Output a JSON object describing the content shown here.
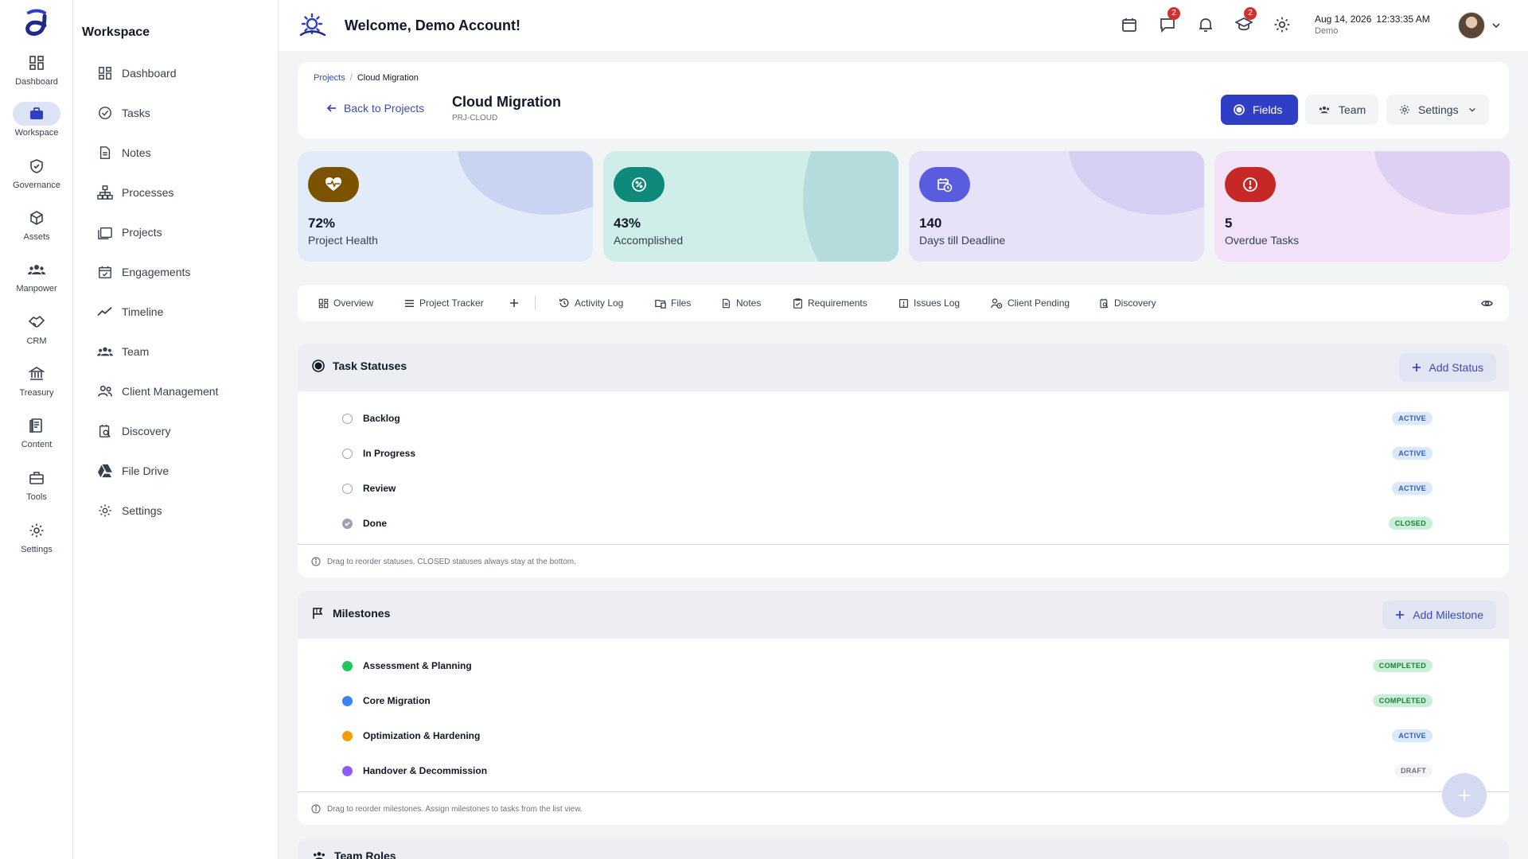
{
  "rail": {
    "items": [
      {
        "label": "Dashboard",
        "icon": "dashboard-icon"
      },
      {
        "label": "Workspace",
        "icon": "briefcase-icon"
      },
      {
        "label": "Governance",
        "icon": "shield-icon"
      },
      {
        "label": "Assets",
        "icon": "cube-icon"
      },
      {
        "label": "Manpower",
        "icon": "people-icon"
      },
      {
        "label": "CRM",
        "icon": "handshake-icon"
      },
      {
        "label": "Treasury",
        "icon": "bank-icon"
      },
      {
        "label": "Content",
        "icon": "document-icon"
      },
      {
        "label": "Tools",
        "icon": "toolbox-icon"
      },
      {
        "label": "Settings",
        "icon": "gear-icon"
      }
    ]
  },
  "sidebar": {
    "title": "Workspace",
    "items": [
      {
        "label": "Dashboard",
        "icon": "dashboard-icon"
      },
      {
        "label": "Tasks",
        "icon": "check-circle-icon"
      },
      {
        "label": "Notes",
        "icon": "note-icon"
      },
      {
        "label": "Processes",
        "icon": "hierarchy-icon"
      },
      {
        "label": "Projects",
        "icon": "folders-icon"
      },
      {
        "label": "Engagements",
        "icon": "calendar-check-icon"
      },
      {
        "label": "Timeline",
        "icon": "trend-icon"
      },
      {
        "label": "Team",
        "icon": "people-icon"
      },
      {
        "label": "Client Management",
        "icon": "clients-icon"
      },
      {
        "label": "Discovery",
        "icon": "search-doc-icon"
      },
      {
        "label": "File Drive",
        "icon": "drive-icon"
      },
      {
        "label": "Settings",
        "icon": "gear-icon"
      }
    ]
  },
  "header": {
    "welcome": "Welcome, Demo Account!",
    "messages_badge": "2",
    "learning_badge": "2",
    "date": "Aug 14, 2026",
    "time": "12:33:35 AM",
    "user": "Demo"
  },
  "project": {
    "breadcrumb_root": "Projects",
    "breadcrumb_sep": "/",
    "breadcrumb_current": "Cloud Migration",
    "back_label": "Back to Projects",
    "name": "Cloud Migration",
    "code": "PRJ-CLOUD",
    "buttons": {
      "fields": "Fields",
      "team": "Team",
      "settings": "Settings"
    }
  },
  "stats": [
    {
      "value": "72%",
      "label": "Project Health",
      "color": "#7a5200"
    },
    {
      "value": "43%",
      "label": "Accomplished",
      "color": "#0f8a7a"
    },
    {
      "value": "140",
      "label": "Days till Deadline",
      "color": "#5a5ce0"
    },
    {
      "value": "5",
      "label": "Overdue Tasks",
      "color": "#c62828"
    }
  ],
  "tabs": [
    "Overview",
    "Project Tracker",
    "Activity Log",
    "Files",
    "Notes",
    "Requirements",
    "Issues Log",
    "Client Pending",
    "Discovery"
  ],
  "statuses": {
    "title": "Task Statuses",
    "add_label": "Add Status",
    "rows": [
      {
        "name": "Backlog",
        "badge": "ACTIVE"
      },
      {
        "name": "In Progress",
        "badge": "ACTIVE"
      },
      {
        "name": "Review",
        "badge": "ACTIVE"
      },
      {
        "name": "Done",
        "badge": "CLOSED"
      }
    ],
    "note": "Drag to reorder statuses. CLOSED statuses always stay at the bottom."
  },
  "milestones": {
    "title": "Milestones",
    "add_label": "Add Milestone",
    "rows": [
      {
        "name": "Assessment & Planning",
        "badge": "COMPLETED",
        "color": "#22c55e"
      },
      {
        "name": "Core Migration",
        "badge": "COMPLETED",
        "color": "#3b82f6"
      },
      {
        "name": "Optimization & Hardening",
        "badge": "ACTIVE",
        "color": "#f59e0b"
      },
      {
        "name": "Handover & Decommission",
        "badge": "DRAFT",
        "color": "#8b5cf6"
      }
    ],
    "note": "Drag to reorder milestones. Assign milestones to tasks from the list view."
  },
  "team_roles": {
    "title": "Team Roles"
  }
}
